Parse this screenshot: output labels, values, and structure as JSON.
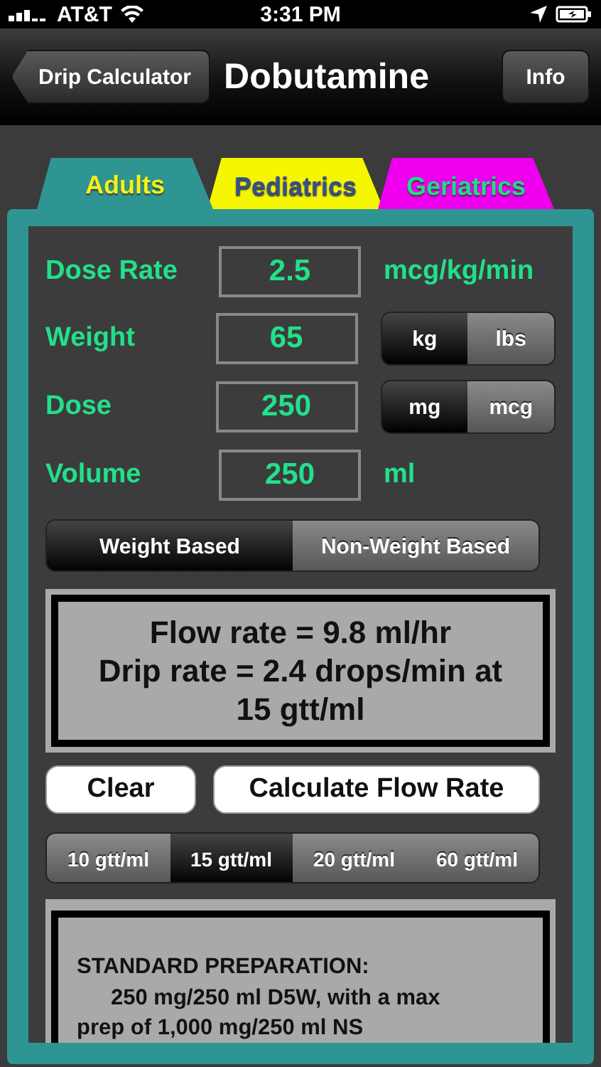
{
  "status_bar": {
    "carrier": "AT&T",
    "time": "3:31 PM"
  },
  "nav": {
    "back": "Drip Calculator",
    "title": "Dobutamine",
    "info": "Info"
  },
  "tabs": [
    {
      "label": "Adults",
      "selected": true,
      "color": "#2f9592"
    },
    {
      "label": "Pediatrics",
      "selected": false,
      "color": "#f6f600"
    },
    {
      "label": "Geriatrics",
      "selected": false,
      "color": "#ee00ee"
    }
  ],
  "fields": [
    {
      "kind": "unit",
      "label": "Dose Rate",
      "value": "2.5",
      "unit": "mcg/kg/min"
    },
    {
      "kind": "toggle",
      "label": "Weight",
      "value": "65",
      "options": [
        {
          "label": "kg",
          "selected": true
        },
        {
          "label": "lbs",
          "selected": false
        }
      ]
    },
    {
      "kind": "toggle",
      "label": "Dose",
      "value": "250",
      "options": [
        {
          "label": "mg",
          "selected": true
        },
        {
          "label": "mcg",
          "selected": false
        }
      ]
    },
    {
      "kind": "unit",
      "label": "Volume",
      "value": "250",
      "unit": "ml"
    }
  ],
  "mode": [
    {
      "label": "Weight Based",
      "selected": true
    },
    {
      "label": "Non-Weight Based",
      "selected": false
    }
  ],
  "result": [
    "Flow rate = 9.8 ml/hr",
    "Drip rate = 2.4 drops/min at 15 gtt/ml"
  ],
  "buttons": [
    "Clear",
    "Calculate Flow Rate"
  ],
  "drop_factors": [
    {
      "label": "10 gtt/ml",
      "selected": false
    },
    {
      "label": "15 gtt/ml",
      "selected": true
    },
    {
      "label": "20 gtt/ml",
      "selected": false
    },
    {
      "label": "60 gtt/ml",
      "selected": false
    }
  ],
  "preparation": {
    "heading": "STANDARD PREPARATION:",
    "text": "250 mg/250 ml D5W, with a max prep of 1,000 mg/250 ml NS"
  }
}
